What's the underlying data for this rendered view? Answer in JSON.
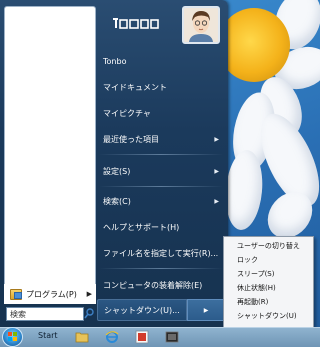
{
  "user": {
    "display_name": "Tonbo"
  },
  "right_menu": {
    "items": [
      {
        "label": "Tonbo",
        "has_arrow": false
      },
      {
        "label": "マイドキュメント",
        "has_arrow": false
      },
      {
        "label": "マイピクチャ",
        "has_arrow": false
      },
      {
        "label": "最近使った項目",
        "has_arrow": true
      },
      {
        "label": "設定(S)",
        "has_arrow": true
      },
      {
        "label": "検索(C)",
        "has_arrow": true
      },
      {
        "label": "ヘルプとサポート(H)",
        "has_arrow": false
      },
      {
        "label": "ファイル名を指定して実行(R)...",
        "has_arrow": false
      },
      {
        "label": "コンピュータの装着解除(E)",
        "has_arrow": false
      }
    ],
    "shutdown_label": "シャットダウン(U)...",
    "arrow_glyph": "▶"
  },
  "left_menu": {
    "programs_label": "プログラム(P)",
    "search_value": "検索"
  },
  "shutdown_submenu": {
    "items": [
      "ユーザーの切り替え",
      "ロック",
      "スリープ(S)",
      "休止状態(H)",
      "再起動(R)",
      "シャットダウン(U)"
    ]
  },
  "taskbar": {
    "start_label": "Start"
  },
  "colors": {
    "menu_bg": "#1b3a5c",
    "taskbar": "#7fa3c2",
    "submenu_bg": "#f4f5f7"
  }
}
